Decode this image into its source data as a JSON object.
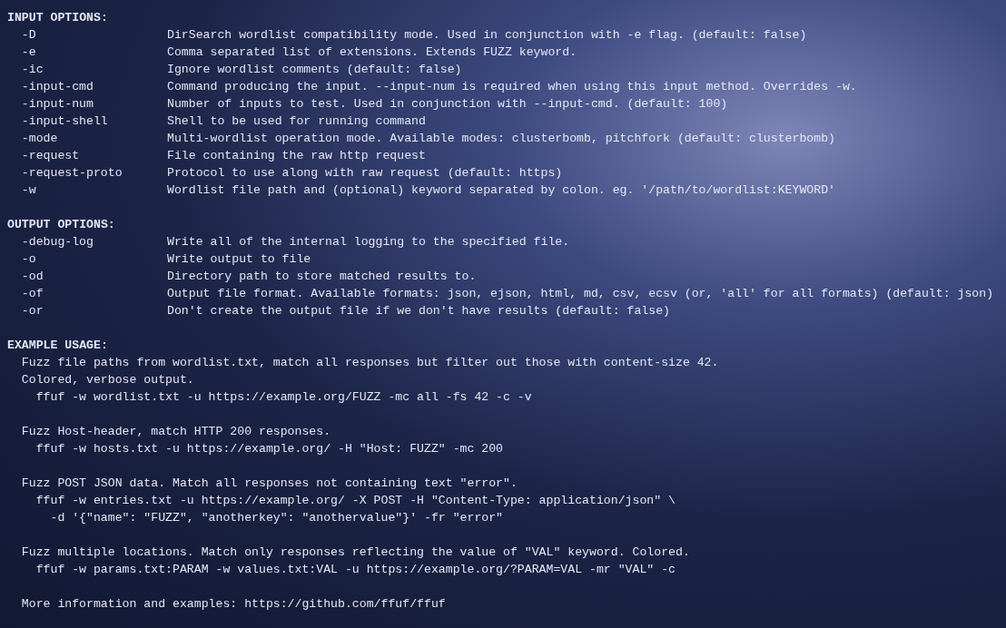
{
  "sections": [
    {
      "title": "INPUT OPTIONS:",
      "options": [
        {
          "flag": "-D",
          "description": "DirSearch wordlist compatibility mode. Used in conjunction with -e flag. (default: false)"
        },
        {
          "flag": "-e",
          "description": "Comma separated list of extensions. Extends FUZZ keyword."
        },
        {
          "flag": "-ic",
          "description": "Ignore wordlist comments (default: false)"
        },
        {
          "flag": "-input-cmd",
          "description": "Command producing the input. --input-num is required when using this input method. Overrides -w."
        },
        {
          "flag": "-input-num",
          "description": "Number of inputs to test. Used in conjunction with --input-cmd. (default: 100)"
        },
        {
          "flag": "-input-shell",
          "description": "Shell to be used for running command"
        },
        {
          "flag": "-mode",
          "description": "Multi-wordlist operation mode. Available modes: clusterbomb, pitchfork (default: clusterbomb)"
        },
        {
          "flag": "-request",
          "description": "File containing the raw http request"
        },
        {
          "flag": "-request-proto",
          "description": "Protocol to use along with raw request (default: https)"
        },
        {
          "flag": "-w",
          "description": "Wordlist file path and (optional) keyword separated by colon. eg. '/path/to/wordlist:KEYWORD'"
        }
      ]
    },
    {
      "title": "OUTPUT OPTIONS:",
      "options": [
        {
          "flag": "-debug-log",
          "description": "Write all of the internal logging to the specified file."
        },
        {
          "flag": "-o",
          "description": "Write output to file"
        },
        {
          "flag": "-od",
          "description": "Directory path to store matched results to."
        },
        {
          "flag": "-of",
          "description": "Output file format. Available formats: json, ejson, html, md, csv, ecsv (or, 'all' for all formats) (default: json)"
        },
        {
          "flag": "-or",
          "description": "Don't create the output file if we don't have results (default: false)"
        }
      ]
    }
  ],
  "example_usage": {
    "title": "EXAMPLE USAGE:",
    "examples": [
      {
        "lines": [
          {
            "kind": "description",
            "text": "Fuzz file paths from wordlist.txt, match all responses but filter out those with content-size 42."
          },
          {
            "kind": "description",
            "text": "Colored, verbose output."
          },
          {
            "kind": "command",
            "text": "ffuf -w wordlist.txt -u https://example.org/FUZZ -mc all -fs 42 -c -v"
          }
        ]
      },
      {
        "lines": [
          {
            "kind": "description",
            "text": "Fuzz Host-header, match HTTP 200 responses."
          },
          {
            "kind": "command",
            "text": "ffuf -w hosts.txt -u https://example.org/ -H \"Host: FUZZ\" -mc 200"
          }
        ]
      },
      {
        "lines": [
          {
            "kind": "description",
            "text": "Fuzz POST JSON data. Match all responses not containing text \"error\"."
          },
          {
            "kind": "command",
            "text": "ffuf -w entries.txt -u https://example.org/ -X POST -H \"Content-Type: application/json\" \\"
          },
          {
            "kind": "continuation",
            "text": "-d '{\"name\": \"FUZZ\", \"anotherkey\": \"anothervalue\"}' -fr \"error\""
          }
        ]
      },
      {
        "lines": [
          {
            "kind": "description",
            "text": "Fuzz multiple locations. Match only responses reflecting the value of \"VAL\" keyword. Colored."
          },
          {
            "kind": "command",
            "text": "ffuf -w params.txt:PARAM -w values.txt:VAL -u https://example.org/?PARAM=VAL -mr \"VAL\" -c"
          }
        ]
      }
    ],
    "footer": "More information and examples: https://github.com/ffuf/ffuf"
  }
}
